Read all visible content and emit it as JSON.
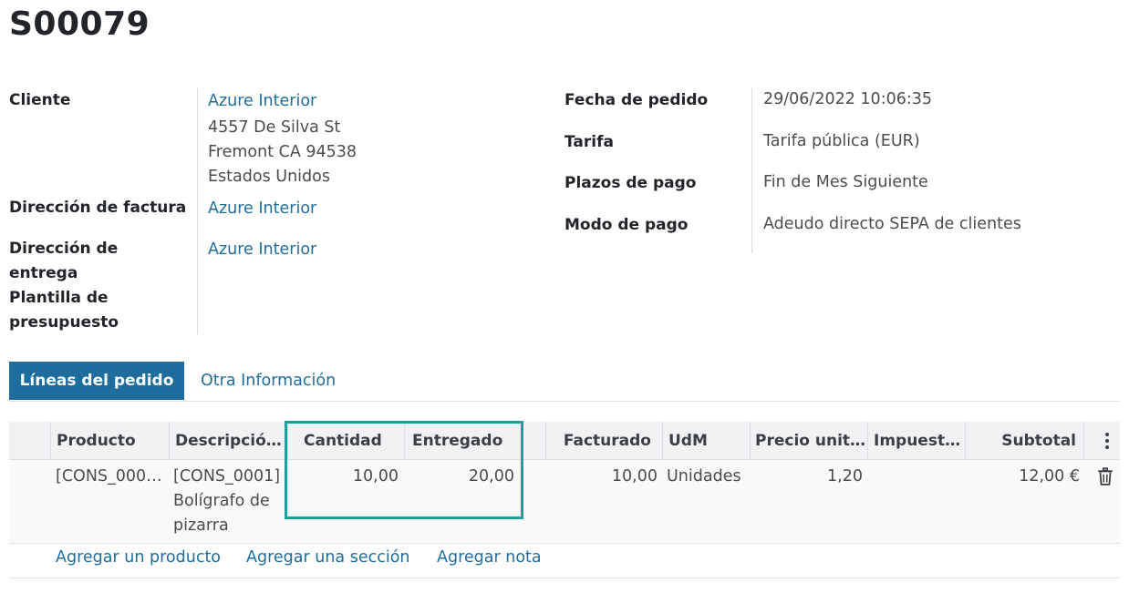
{
  "order": {
    "name": "S00079"
  },
  "left_fields": {
    "customer_label": "Cliente",
    "customer_name": "Azure Interior",
    "address_line1": "4557 De Silva St",
    "address_line2": "Fremont CA 94538",
    "address_line3": "Estados Unidos",
    "invoice_label": "Dirección de factura",
    "invoice_value": "Azure Interior",
    "delivery_label_1": "Dirección de",
    "delivery_label_2": "entrega",
    "delivery_value": "Azure Interior",
    "template_label_1": "Plantilla de",
    "template_label_2": "presupuesto"
  },
  "right_fields": {
    "date_label": "Fecha de pedido",
    "date_value": "29/06/2022 10:06:35",
    "pricelist_label": "Tarifa",
    "pricelist_value": "Tarifa pública (EUR)",
    "terms_label": "Plazos de pago",
    "terms_value": "Fin de Mes Siguiente",
    "mode_label": "Modo de pago",
    "mode_value": "Adeudo directo SEPA de clientes"
  },
  "tabs": [
    {
      "label": "Líneas del pedido",
      "active": true
    },
    {
      "label": "Otra Información",
      "active": false
    }
  ],
  "table": {
    "headers": {
      "product": "Producto",
      "description": "Descripció…",
      "quantity": "Cantidad",
      "delivered": "Entregado",
      "invoiced": "Facturado",
      "uom": "UdM",
      "unit_price": "Precio unit…",
      "taxes": "Impuest…",
      "subtotal": "Subtotal"
    },
    "rows": [
      {
        "product": "[CONS_000…",
        "description_1": "[CONS_0001]",
        "description_2": "Bolígrafo de",
        "description_3": "pizarra",
        "quantity": "10,00",
        "delivered": "20,00",
        "invoiced": "10,00",
        "uom": "Unidades",
        "unit_price": "1,20",
        "taxes": "",
        "subtotal": "12,00 €"
      }
    ],
    "add_links": {
      "product": "Agregar un producto",
      "section": "Agregar una sección",
      "note": "Agregar nota"
    }
  },
  "icons": {
    "row_action": "trash-icon",
    "column_options": "kebab-menu-icon"
  },
  "colors": {
    "primary": "#1f6d9d",
    "highlight": "#12a39a"
  }
}
